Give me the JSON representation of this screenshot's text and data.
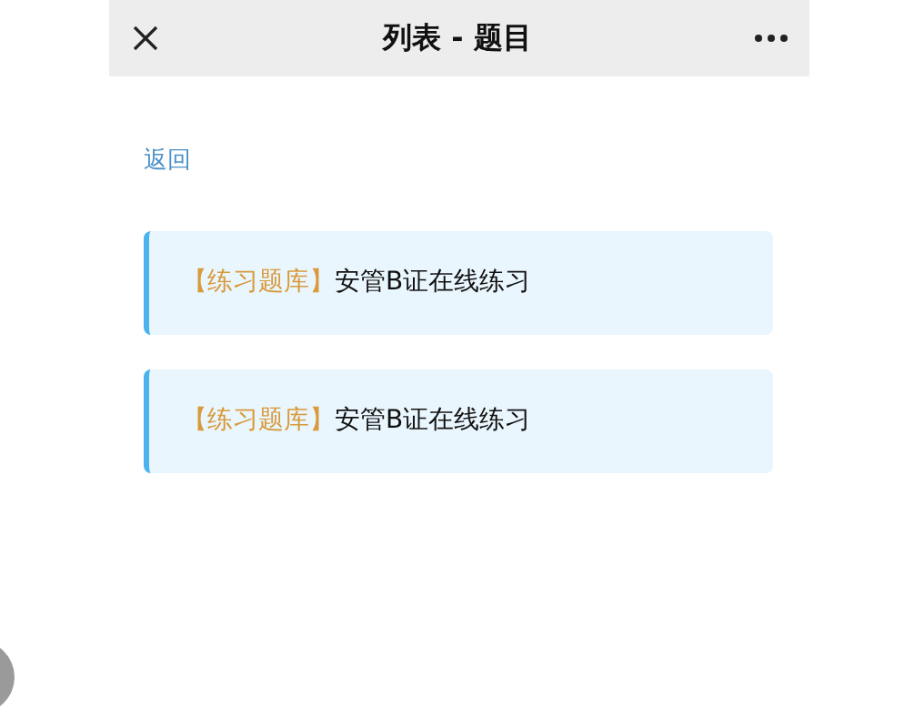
{
  "header": {
    "title": "列表 - 题目"
  },
  "back_link": "返回",
  "items": [
    {
      "tag": "【练习题库】",
      "title": "安管B证在线练习"
    },
    {
      "tag": "【练习题库】",
      "title": "安管B证在线练习"
    }
  ]
}
